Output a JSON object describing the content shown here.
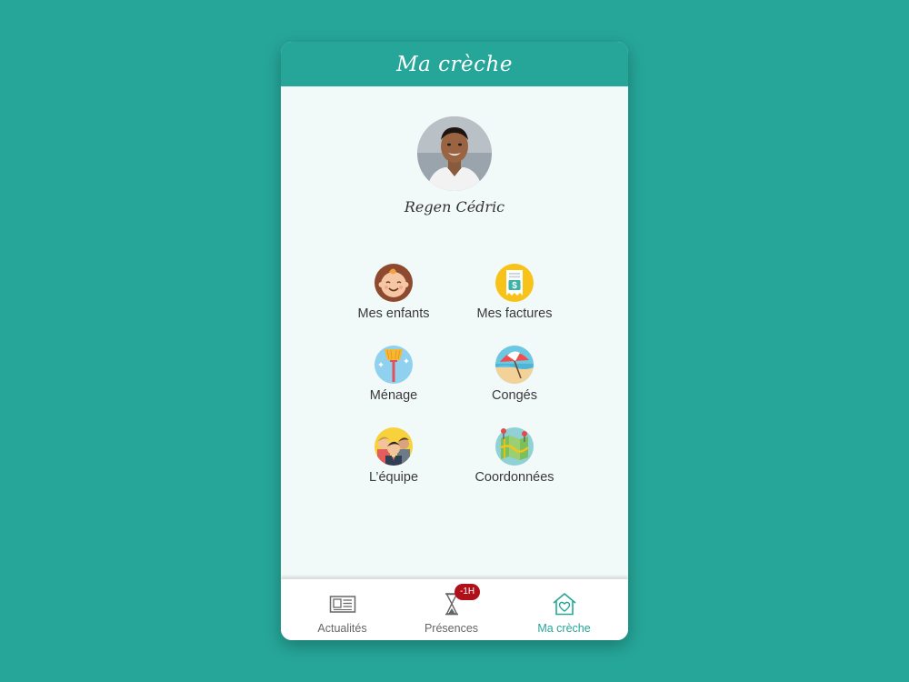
{
  "header": {
    "title": "Ma crèche"
  },
  "profile": {
    "name": "Regen Cédric"
  },
  "menu": {
    "items": [
      {
        "label": "Mes enfants",
        "icon": "baby-face-icon"
      },
      {
        "label": "Mes factures",
        "icon": "invoice-icon"
      },
      {
        "label": "Ménage",
        "icon": "broom-icon"
      },
      {
        "label": "Congés",
        "icon": "beach-umbrella-icon"
      },
      {
        "label": "L’équipe",
        "icon": "team-icon"
      },
      {
        "label": "Coordonnées",
        "icon": "map-pin-icon"
      }
    ]
  },
  "tabbar": {
    "tabs": [
      {
        "label": "Actualités",
        "icon": "newspaper-icon"
      },
      {
        "label": "Présences",
        "icon": "hourglass-icon",
        "badge": "-1H"
      },
      {
        "label": "Ma crèche",
        "icon": "house-heart-icon"
      }
    ],
    "active_index": 2
  },
  "colors": {
    "background": "#26a699",
    "accent": "#26a699",
    "badge": "#b0101a",
    "content_bg": "#f2f9f9"
  }
}
